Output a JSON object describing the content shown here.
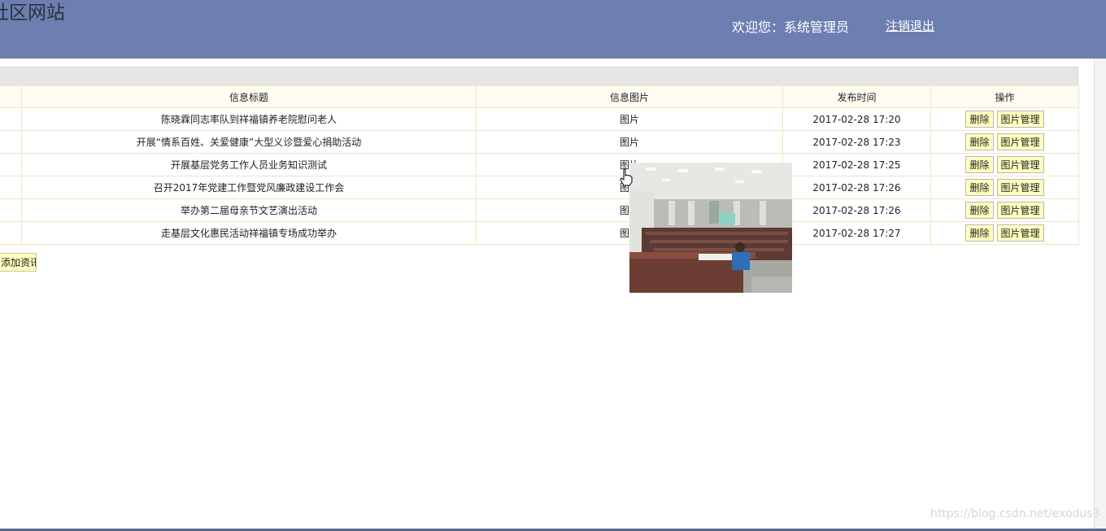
{
  "header": {
    "site_title": "社区网站",
    "welcome_text": "欢迎您：系统管理员",
    "logout_label": "注销退出"
  },
  "table": {
    "columns": [
      "",
      "信息标题",
      "信息图片",
      "发布时间",
      "操作"
    ],
    "rows": [
      {
        "title": "陈晓霖同志率队到祥福镇养老院慰问老人",
        "image_link": "图片",
        "time": "2017-02-28 17:20"
      },
      {
        "title": "开展“情系百姓、关爱健康”大型义诊暨爱心捐助活动",
        "image_link": "图片",
        "time": "2017-02-28 17:23"
      },
      {
        "title": "开展基层党务工作人员业务知识测试",
        "image_link": "图片",
        "time": "2017-02-28 17:25"
      },
      {
        "title": "召开2017年党建工作暨党风廉政建设工作会",
        "image_link": "图片",
        "time": "2017-02-28 17:26"
      },
      {
        "title": "举办第二届母亲节文艺演出活动",
        "image_link": "图片",
        "time": "2017-02-28 17:26"
      },
      {
        "title": "走基层文化惠民活动祥福镇专场成功举办",
        "image_link": "图片",
        "time": "2017-02-28 17:27"
      }
    ],
    "delete_label": "删除",
    "manage_label": "图片管理"
  },
  "add_button_label": "添加资讯",
  "watermark": "https://blog.csdn.net/exodus3",
  "colors": {
    "header_bg": "#6c7fb0",
    "button_bg": "#ffffbf",
    "table_border": "#f0e6bf"
  }
}
